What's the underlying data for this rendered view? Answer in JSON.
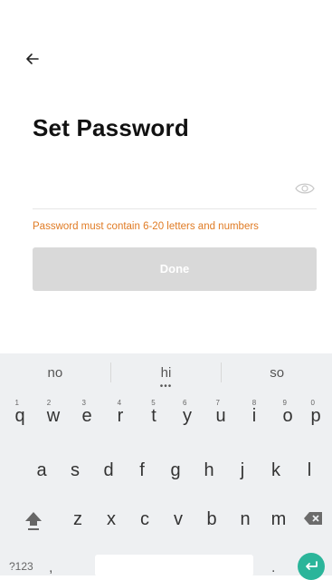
{
  "header": {
    "back_icon": "arrow-left-icon"
  },
  "page": {
    "title": "Set Password"
  },
  "password_field": {
    "value": "",
    "placeholder": "",
    "toggle_icon": "eye-icon"
  },
  "hint": {
    "text": "Password must contain 6-20 letters and numbers",
    "color": "#e07b24"
  },
  "done_button": {
    "label": "Done",
    "color": "#d9d9d9"
  },
  "keyboard": {
    "suggestions": [
      "no",
      "hi",
      "so"
    ],
    "row1": [
      {
        "k": "q",
        "n": "1"
      },
      {
        "k": "w",
        "n": "2"
      },
      {
        "k": "e",
        "n": "3"
      },
      {
        "k": "r",
        "n": "4"
      },
      {
        "k": "t",
        "n": "5"
      },
      {
        "k": "y",
        "n": "6"
      },
      {
        "k": "u",
        "n": "7"
      },
      {
        "k": "i",
        "n": "8"
      },
      {
        "k": "o",
        "n": "9"
      },
      {
        "k": "p",
        "n": "0"
      }
    ],
    "row2": [
      "a",
      "s",
      "d",
      "f",
      "g",
      "h",
      "j",
      "k",
      "l"
    ],
    "row3": [
      "z",
      "x",
      "c",
      "v",
      "b",
      "n",
      "m"
    ],
    "mode_label": "?123",
    "comma": ",",
    "period": ".",
    "shift_icon": "shift-icon",
    "backspace_icon": "backspace-icon",
    "enter_icon": "enter-icon",
    "enter_color": "#2bb59a"
  }
}
